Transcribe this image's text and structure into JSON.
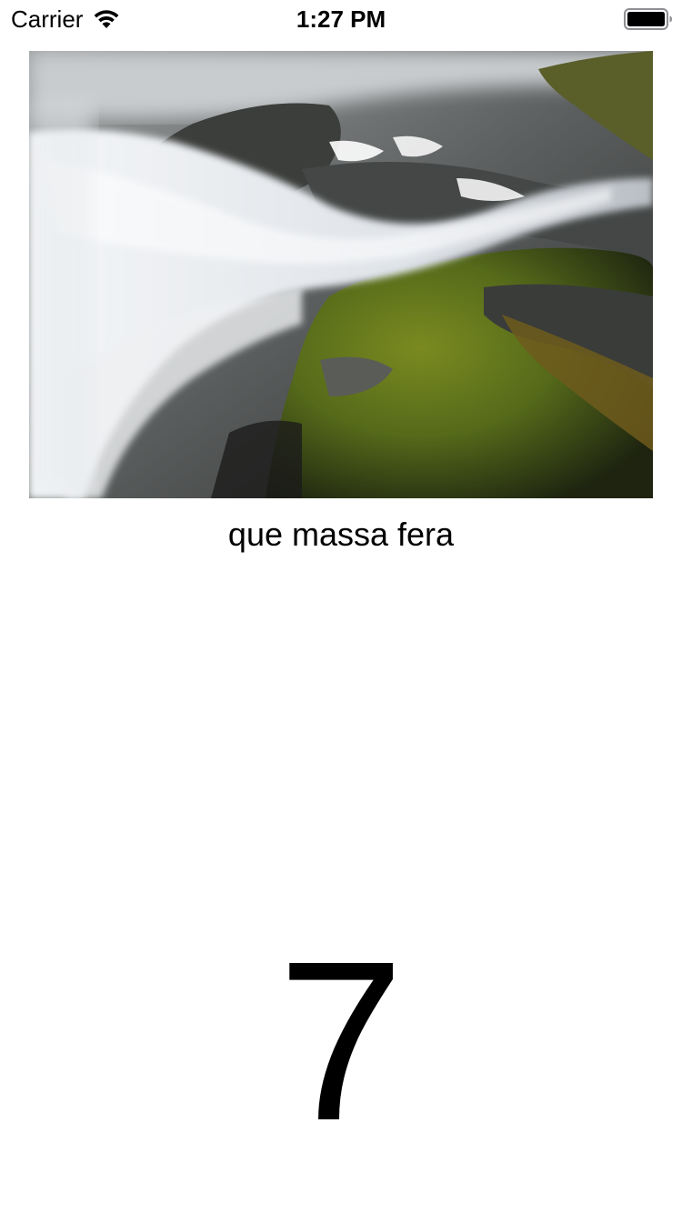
{
  "status_bar": {
    "carrier": "Carrier",
    "time": "1:27 PM",
    "wifi_icon": "wifi-icon",
    "battery_icon": "battery-full-icon"
  },
  "photo": {
    "subject": "waterfall-over-mossy-rocks"
  },
  "caption": "que massa fera",
  "counter": "7"
}
